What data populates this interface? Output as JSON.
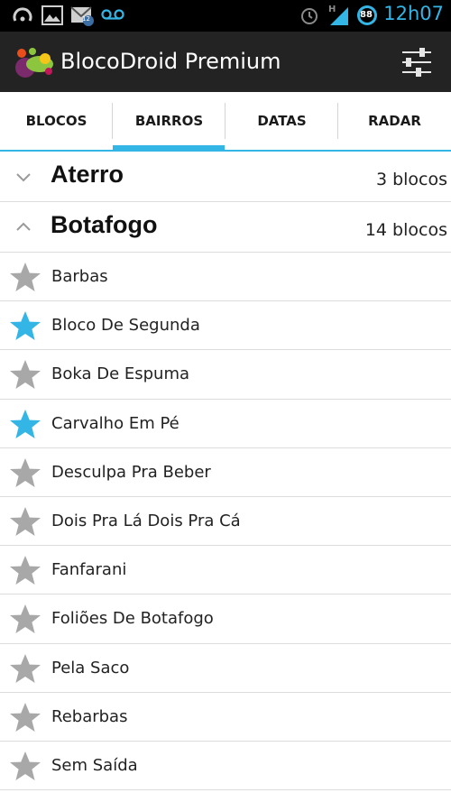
{
  "status_bar": {
    "clock": "12h07",
    "battery_level": "88",
    "network_type": "H",
    "email_badge": "12",
    "icons": [
      "arc-icon",
      "gallery-icon",
      "gmail-icon",
      "voicemail-icon",
      "alarm-icon",
      "signal-icon",
      "battery-icon"
    ]
  },
  "action_bar": {
    "title": "BlocoDroid Premium",
    "logo_icon": "app-logo-icon",
    "settings_icon": "sliders-icon"
  },
  "tabs": [
    {
      "label": "BLOCOS",
      "selected": false
    },
    {
      "label": "BAIRROS",
      "selected": true
    },
    {
      "label": "DATAS",
      "selected": false
    },
    {
      "label": "RADAR",
      "selected": false
    }
  ],
  "groups": [
    {
      "name": "Aterro",
      "count": "3 blocos",
      "expanded": false
    },
    {
      "name": "Botafogo",
      "count": "14 blocos",
      "expanded": true
    }
  ],
  "items": [
    {
      "name": "Barbas",
      "favorite": false
    },
    {
      "name": "Bloco De Segunda",
      "favorite": true
    },
    {
      "name": "Boka De Espuma",
      "favorite": false
    },
    {
      "name": "Carvalho Em Pé",
      "favorite": true
    },
    {
      "name": "Desculpa Pra Beber",
      "favorite": false
    },
    {
      "name": "Dois Pra Lá Dois Pra Cá",
      "favorite": false
    },
    {
      "name": "Fanfarani",
      "favorite": false
    },
    {
      "name": "Foliões De Botafogo",
      "favorite": false
    },
    {
      "name": "Pela Saco",
      "favorite": false
    },
    {
      "name": "Rebarbas",
      "favorite": false
    },
    {
      "name": "Sem Saída",
      "favorite": false
    }
  ],
  "colors": {
    "accent": "#33b5e5",
    "star_favorite": "#33b5e5",
    "star_default": "#a8a8a8",
    "action_bar": "#232323",
    "status_bar": "#000000"
  }
}
